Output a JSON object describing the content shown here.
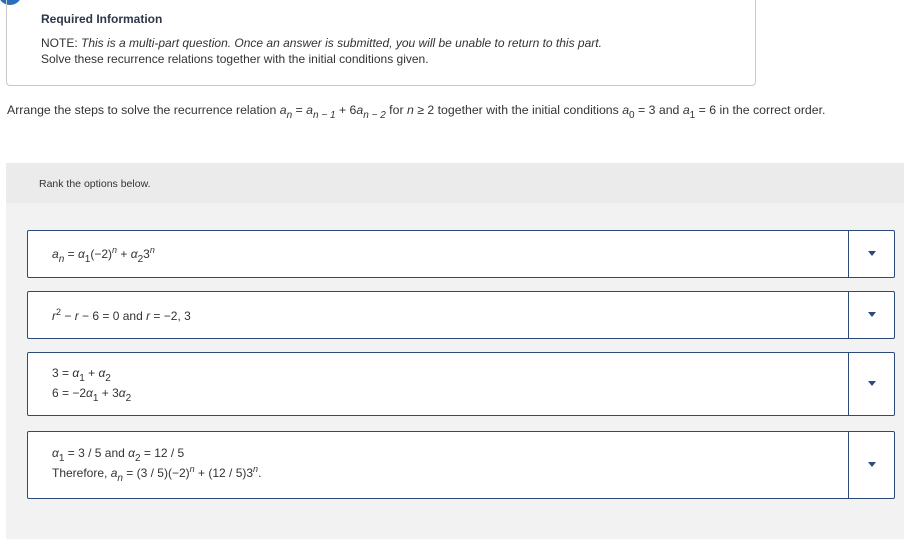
{
  "info": {
    "title": "Required Information",
    "note_label": "NOTE: ",
    "note_text": "This is a multi-part question. Once an answer is submitted, you will be unable to return to this part.",
    "line2": "Solve these recurrence relations together with the initial conditions given."
  },
  "question": {
    "p1": "Arrange the steps to solve the recurrence relation ",
    "p2": " together with the initial conditions ",
    "p3": " in the correct order."
  },
  "rank": {
    "label": "Rank the options below."
  },
  "items": [
    {
      "text": "an = α1(−2)n + α23n"
    },
    {
      "text": "r2 − r − 6 = 0 and r = −2, 3"
    },
    {
      "line1": "3 = α1 + α2",
      "line2": "6 = −2α1 + 3α2"
    },
    {
      "line1": "α1 = 3 / 5 and α2 = 12 / 5",
      "line2": "Therefore, an = (3 / 5)(−2)n + (12 / 5)3n."
    }
  ],
  "icons": {
    "dropdown": "caret-down-icon"
  },
  "colors": {
    "accent": "#2a6ebb",
    "border": "#2c4a7a",
    "header_bg": "#ebebeb",
    "area_bg": "#f2f2f2"
  }
}
